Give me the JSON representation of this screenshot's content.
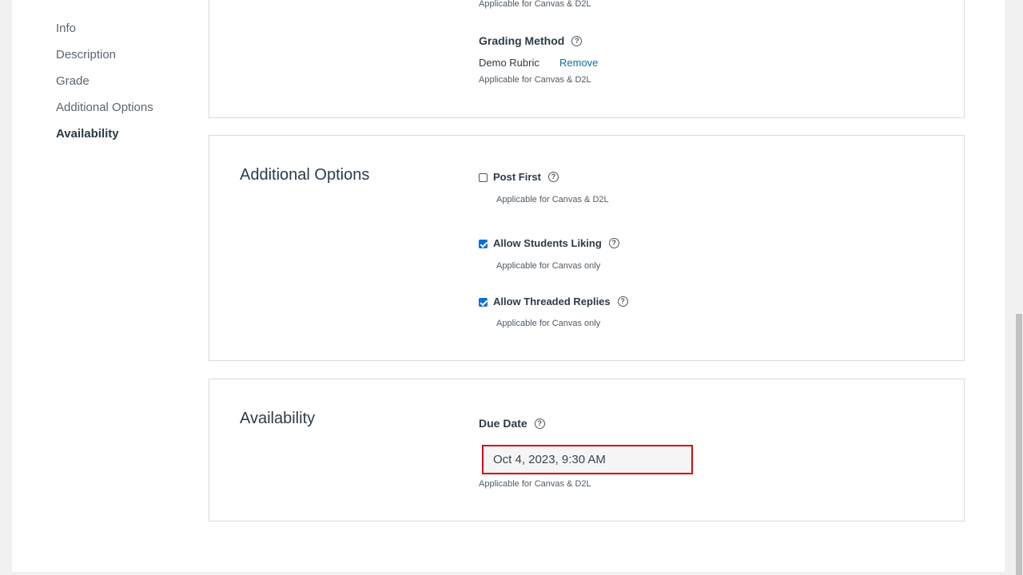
{
  "nav": {
    "items": [
      {
        "label": "Info"
      },
      {
        "label": "Description"
      },
      {
        "label": "Grade"
      },
      {
        "label": "Additional Options"
      },
      {
        "label": "Availability",
        "active": true
      }
    ]
  },
  "grade_card": {
    "top_note": "Applicable for Canvas & D2L",
    "grading_method_label": "Grading Method",
    "rubric_name": "Demo Rubric",
    "remove_label": "Remove",
    "rubric_note": "Applicable for Canvas & D2L"
  },
  "options_card": {
    "title": "Additional Options",
    "options": [
      {
        "label": "Post First",
        "checked": false,
        "note": "Applicable for Canvas & D2L"
      },
      {
        "label": "Allow Students Liking",
        "checked": true,
        "note": "Applicable for Canvas only"
      },
      {
        "label": "Allow Threaded Replies",
        "checked": true,
        "note": "Applicable for Canvas only"
      }
    ]
  },
  "availability_card": {
    "title": "Availability",
    "due_date_label": "Due Date",
    "due_date_value": "Oct 4, 2023, 9:30 AM",
    "note": "Applicable for Canvas & D2L"
  },
  "icons": {
    "help": "question-circle-icon",
    "checkbox": "checkbox-icon"
  },
  "colors": {
    "link": "#0770a3",
    "checkbox_checked": "#0b6fd8",
    "highlight_border": "#d40a15"
  }
}
